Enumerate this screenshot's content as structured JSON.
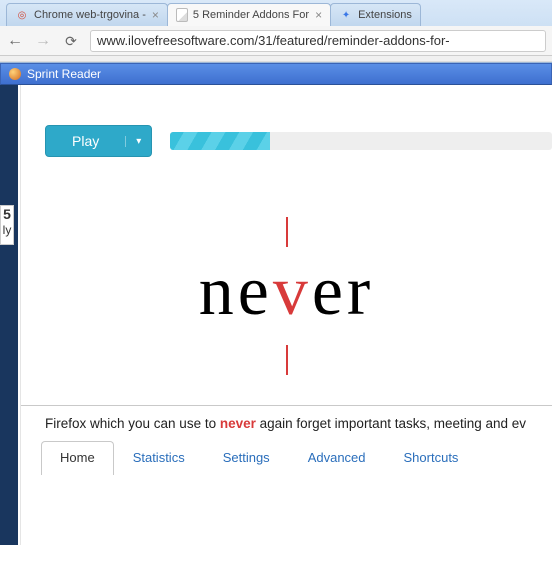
{
  "browser": {
    "tabs": [
      {
        "title": "Chrome web-trgovina - ",
        "favicon": "chrome"
      },
      {
        "title": "5 Reminder Addons For ",
        "favicon": "page"
      },
      {
        "title": "Extensions",
        "favicon": "ext"
      }
    ],
    "active_tab_index": 1,
    "url_display": "www.ilovefreesoftware.com/31/featured/reminder-addons-for-"
  },
  "app": {
    "title": "Sprint Reader",
    "play_label": "Play",
    "progress_fraction": 0.26
  },
  "word": {
    "pre": "ne",
    "pivot": "v",
    "post": "er"
  },
  "context": {
    "pre": "Firefox which you can use to ",
    "hl": "never",
    "post": " again forget important tasks, meeting and ev"
  },
  "bottom_tabs": {
    "items": [
      "Home",
      "Statistics",
      "Settings",
      "Advanced",
      "Shortcuts"
    ],
    "active_index": 0
  },
  "left_label_big": "5",
  "left_label_small": "ly"
}
